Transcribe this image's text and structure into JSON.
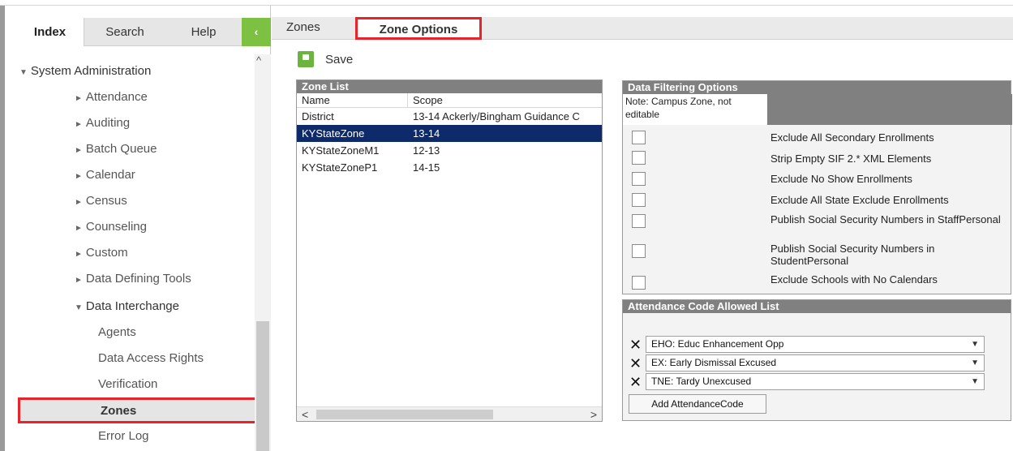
{
  "left_tabs": {
    "index": "Index",
    "search": "Search",
    "help": "Help",
    "collapse_glyph": "‹"
  },
  "tree": {
    "root": "System Administration",
    "items": [
      "Attendance",
      "Auditing",
      "Batch Queue",
      "Calendar",
      "Census",
      "Counseling",
      "Custom",
      "Data Defining Tools"
    ],
    "open_group": "Data Interchange",
    "leaves": [
      "Agents",
      "Data Access Rights",
      "Verification",
      "Zones",
      "Error Log"
    ],
    "selected": "Zones"
  },
  "top_tabs": {
    "zones": "Zones",
    "zone_options": "Zone Options"
  },
  "toolbar": {
    "save_label": "Save"
  },
  "zone_list": {
    "title": "Zone List",
    "columns": [
      "Name",
      "Scope"
    ],
    "rows": [
      {
        "name": "District",
        "scope": "13-14 Ackerly/Bingham Guidance C"
      },
      {
        "name": "KYStateZone",
        "scope": "13-14"
      },
      {
        "name": "KYStateZoneM1",
        "scope": "12-13"
      },
      {
        "name": "KYStateZoneP1",
        "scope": "14-15"
      }
    ],
    "selected_row": 1
  },
  "filter": {
    "title": "Data Filtering Options",
    "note": "Note: Campus Zone, not editable",
    "options": [
      "Exclude All Secondary Enrollments",
      "Strip Empty SIF 2.* XML Elements",
      "Exclude No Show Enrollments",
      "Exclude All State Exclude Enrollments",
      "Publish Social Security Numbers in StaffPersonal",
      "Publish Social Security Numbers in StudentPersonal",
      "Exclude Schools with No Calendars"
    ]
  },
  "attendance": {
    "title": "Attendance Code Allowed List",
    "codes": [
      "EHO: Educ Enhancement Opp",
      "EX: Early Dismissal Excused",
      "TNE: Tardy Unexcused"
    ],
    "add_label": "Add AttendanceCode"
  }
}
